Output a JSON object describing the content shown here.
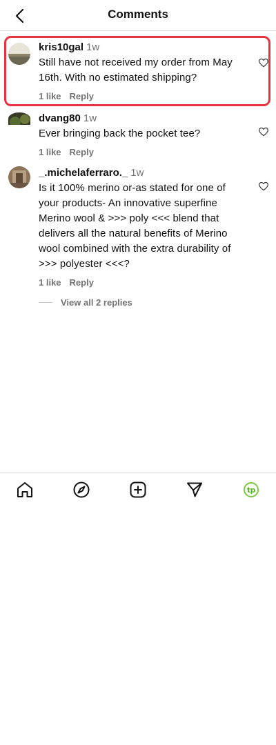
{
  "header": {
    "title": "Comments"
  },
  "comments": [
    {
      "username": "kris10gal",
      "time": "1w",
      "text": "Still have not received my order from May 16th. With no estimated shipping?",
      "likes": "1 like",
      "reply": "Reply"
    },
    {
      "username": "dvang80",
      "time": "1w",
      "text": "Ever bringing back the pocket tee?",
      "likes": "1 like",
      "reply": "Reply"
    },
    {
      "username": "_.michelaferraro._",
      "time": "1w",
      "text": "Is it 100% merino or-as stated for one of your products- An innovative superfine Merino wool & >>> poly <<< blend that delivers all the natural benefits of Merino wool combined with the extra durability of >>> polyester <<<?",
      "likes": "1 like",
      "reply": "Reply",
      "view_replies": "View all 2 replies"
    }
  ],
  "nav": {
    "icons": [
      "home-icon",
      "explore-icon",
      "create-icon",
      "direct-message-icon",
      "profile-icon"
    ],
    "profile_badge": "tp",
    "profile_color": "#7ac943"
  },
  "colors": {
    "highlight": "#e8323f",
    "secondary_text": "#737373"
  }
}
